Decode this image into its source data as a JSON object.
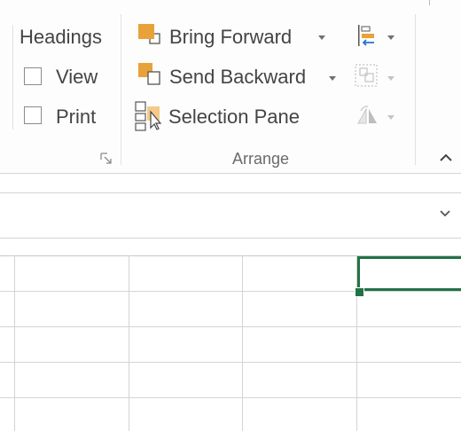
{
  "show_group": {
    "headings_label": "Headings",
    "view_label": "View",
    "view_checked": false,
    "print_label": "Print",
    "print_checked": false
  },
  "arrange_group": {
    "label": "Arrange",
    "bring_forward_label": "Bring Forward",
    "send_backward_label": "Send Backward",
    "selection_pane_label": "Selection Pane",
    "icons": [
      "bring-forward-icon",
      "send-backward-icon",
      "selection-pane-icon",
      "align-icon",
      "group-icon",
      "rotate-icon"
    ]
  },
  "colors": {
    "accent_green": "#217346",
    "icon_orange": "#e8a23a",
    "icon_light_orange": "#f4c98a",
    "icon_blue": "#2a72c4",
    "text": "#444444"
  },
  "grid": {
    "columns": 4,
    "rows": 5,
    "active_cell": "top-right"
  }
}
